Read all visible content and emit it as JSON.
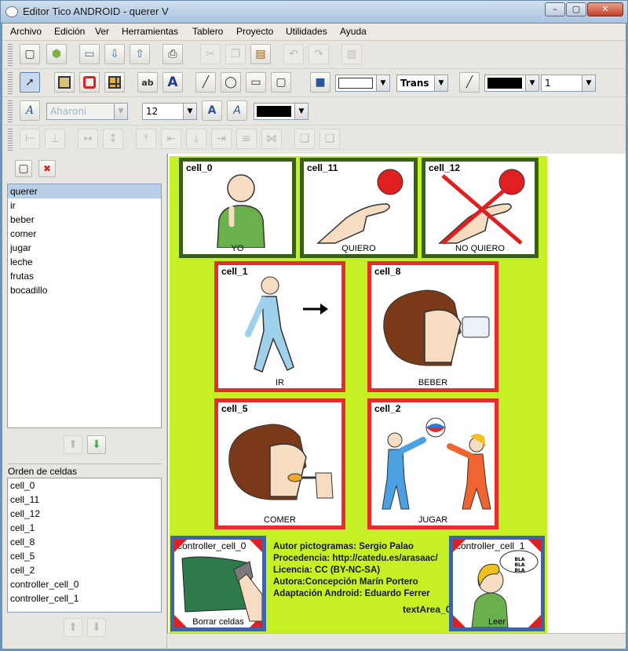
{
  "window": {
    "title": "Editor Tico ANDROID - querer V",
    "minimize": "–",
    "restore": "▢",
    "close": "✕"
  },
  "menus": [
    "Archivo",
    "Edición",
    "Ver",
    "Herramientas",
    "Tablero",
    "Proyecto",
    "Utilidades",
    "Ayuda"
  ],
  "toolbar": {
    "row1_icons": [
      "new-board-icon",
      "android-icon",
      "open-folder-icon",
      "import-icon",
      "export-icon",
      "print-icon",
      "cut-icon",
      "copy-icon",
      "paste-icon",
      "undo-icon",
      "redo-icon",
      "delete-icon"
    ],
    "font_name": "Aharoni",
    "font_size": "12",
    "fill_mode": "Trans",
    "line_width": "1",
    "colors": {
      "fill_swatch": "#ffffff",
      "line_swatch": "#000000",
      "text_swatch": "#000000"
    }
  },
  "boards": {
    "items": [
      "querer",
      "ir",
      "beber",
      "comer",
      "jugar",
      "leche",
      "frutas",
      "bocadillo"
    ],
    "selected": "querer"
  },
  "cell_order": {
    "title": "Orden de celdas",
    "items": [
      "cell_0",
      "cell_11",
      "cell_12",
      "cell_1",
      "cell_8",
      "cell_5",
      "cell_2",
      "controller_cell_0",
      "controller_cell_1"
    ]
  },
  "board": {
    "background": "#c5f023",
    "cells": [
      {
        "id": "cell_0",
        "caption": "YO",
        "border": "#3a6018"
      },
      {
        "id": "cell_11",
        "caption": "QUIERO",
        "border": "#3a6018"
      },
      {
        "id": "cell_12",
        "caption": "NO QUIERO",
        "border": "#3a6018"
      },
      {
        "id": "cell_1",
        "caption": "IR",
        "border": "#e82c2c"
      },
      {
        "id": "cell_8",
        "caption": "BEBER",
        "border": "#e82c2c"
      },
      {
        "id": "cell_5",
        "caption": "COMER",
        "border": "#e82c2c"
      },
      {
        "id": "cell_2",
        "caption": "JUGAR",
        "border": "#e82c2c"
      },
      {
        "id": "controller_cell_0",
        "caption": "Borrar celdas",
        "border": "#3d64a8"
      },
      {
        "id": "controller_cell_1",
        "caption": "Leer",
        "border": "#3d64a8"
      }
    ],
    "speech_bubble": "BLA BLA BLA",
    "credits": [
      "Autor pictogramas: Sergio Palao",
      "Procedencia: http://catedu.es/arasaac/",
      "Licencia: CC (BY-NC-SA)",
      "Autora:Concepción Marín Portero",
      "Adaptación Android: Eduardo Ferrer"
    ],
    "text_area_label": "textArea_0"
  }
}
